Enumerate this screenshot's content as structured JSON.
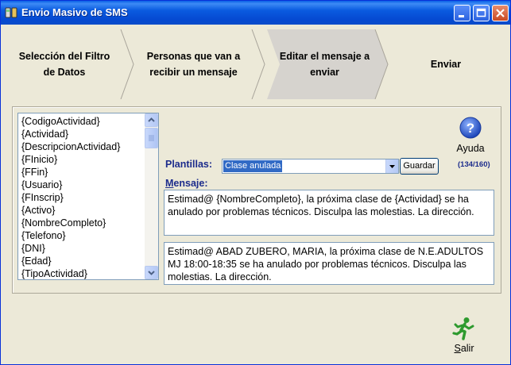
{
  "window": {
    "title": "Envio Masivo de SMS"
  },
  "wizard": {
    "steps": [
      {
        "line1": "Selección del Filtro",
        "line2": "de Datos"
      },
      {
        "line1": "Personas que van a",
        "line2": "recibir un mensaje"
      },
      {
        "line1": "Editar el mensaje a",
        "line2": "enviar",
        "active": true
      },
      {
        "line1": "Enviar",
        "line2": ""
      }
    ]
  },
  "fields": {
    "items": [
      "{CodigoActividad}",
      "{Actividad}",
      "{DescripcionActividad}",
      "{FInicio}",
      "{FFin}",
      "{Usuario}",
      "{FInscrip}",
      "{Activo}",
      "{NombreCompleto}",
      "{Telefono}",
      "{DNI}",
      "{Edad}",
      "{TipoActividad}"
    ]
  },
  "help": {
    "label": "Ayuda",
    "icon": "help-question-icon"
  },
  "templates": {
    "label": "Plantillas:",
    "selected": "Clase anulada",
    "save_label": "Guardar",
    "counter": "(134/160)"
  },
  "message": {
    "label_first": "M",
    "label_rest": "ensaje:",
    "template_text": "Estimad@ {NombreCompleto}, la próxima clase de {Actividad} se ha anulado por problemas técnicos. Disculpa las molestias. La dirección.",
    "preview_text": "Estimad@ ABAD ZUBERO, MARIA, la próxima clase de N.E.ADULTOS MJ 18:00-18:35 se ha anulado por problemas técnicos. Disculpa las molestias. La dirección."
  },
  "exit": {
    "label_first": "S",
    "label_rest": "alir",
    "icon": "running-man-icon"
  },
  "colors": {
    "titlebar": "#0a5be0",
    "label_blue": "#1c2c8c",
    "selection": "#316ac5",
    "active_step": "#d6d3ce"
  }
}
